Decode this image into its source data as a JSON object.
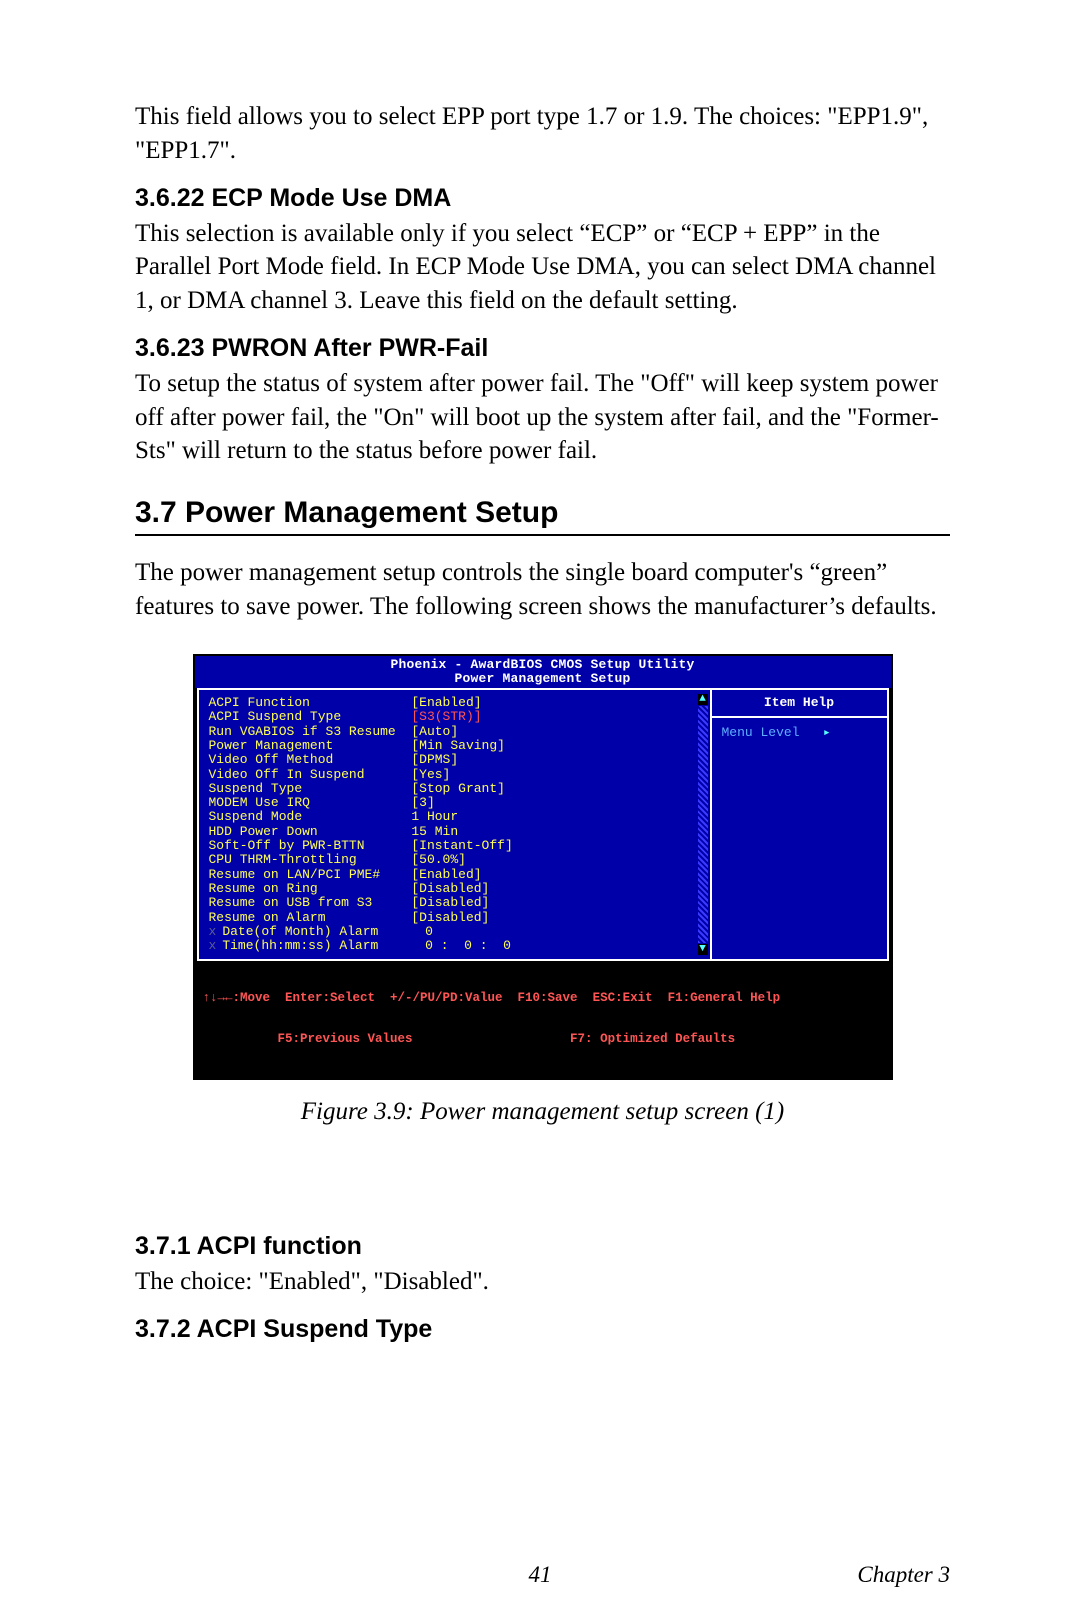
{
  "intro_para": "This field allows you to select EPP port type 1.7 or 1.9. The choices: \"EPP1.9\", \"EPP1.7\".",
  "h_ecp": "3.6.22 ECP Mode Use DMA",
  "p_ecp": "This selection is available only if you select “ECP” or “ECP + EPP” in the Parallel Port Mode field. In ECP Mode Use DMA, you can select DMA channel 1, or DMA channel 3. Leave this field on the default setting.",
  "h_pwron": "3.6.23 PWRON After PWR-Fail",
  "p_pwron": "To setup the status of system after power fail. The \"Off\" will keep system power off after power fail, the \"On\" will boot up the system after fail, and the \"Former-Sts\" will return to the status before power fail.",
  "h_pm": "3.7  Power Management Setup",
  "p_pm": "The power management setup controls the single board computer's “green” features to save power. The following screen shows the manufacturer’s defaults.",
  "bios": {
    "title1": "Phoenix - AwardBIOS CMOS Setup Utility",
    "title2": "Power Management Setup",
    "help_header": "Item Help",
    "help_body": "Menu Level",
    "rows": [
      {
        "label": "ACPI Function",
        "value": "[Enabled]",
        "dim": false,
        "hl": false
      },
      {
        "label": "ACPI Suspend Type",
        "value": "[S3(STR)]",
        "dim": false,
        "hl": true
      },
      {
        "label": "Run VGABIOS if S3 Resume",
        "value": "[Auto]",
        "dim": false,
        "hl": false
      },
      {
        "label": "Power Management",
        "value": "[Min Saving]",
        "dim": false,
        "hl": false
      },
      {
        "label": "Video Off Method",
        "value": "[DPMS]",
        "dim": false,
        "hl": false
      },
      {
        "label": "Video Off In Suspend",
        "value": "[Yes]",
        "dim": false,
        "hl": false
      },
      {
        "label": "Suspend Type",
        "value": "[Stop Grant]",
        "dim": false,
        "hl": false
      },
      {
        "label": "MODEM Use IRQ",
        "value": "[3]",
        "dim": false,
        "hl": false
      },
      {
        "label": "Suspend Mode",
        "value": "1 Hour",
        "dim": true,
        "hl": false
      },
      {
        "label": "HDD Power Down",
        "value": "15 Min",
        "dim": true,
        "hl": false
      },
      {
        "label": "Soft-Off by PWR-BTTN",
        "value": "[Instant-Off]",
        "dim": false,
        "hl": false
      },
      {
        "label": "CPU THRM-Throttling",
        "value": "[50.0%]",
        "dim": false,
        "hl": false
      },
      {
        "label": "Resume on LAN/PCI PME#",
        "value": "[Enabled]",
        "dim": false,
        "hl": false
      },
      {
        "label": "Resume on Ring",
        "value": "[Disabled]",
        "dim": false,
        "hl": false
      },
      {
        "label": "Resume on USB from S3",
        "value": "[Disabled]",
        "dim": false,
        "hl": false
      },
      {
        "label": "Resume on Alarm",
        "value": "[Disabled]",
        "dim": false,
        "hl": false
      },
      {
        "label": "Date(of Month) Alarm",
        "value": "0",
        "dim": true,
        "hl": false,
        "x": true
      },
      {
        "label": "Time(hh:mm:ss) Alarm",
        "value": "0 :  0 :  0",
        "dim": true,
        "hl": false,
        "x": true
      }
    ],
    "footer1": "↑↓→←:Move  Enter:Select  +/-/PU/PD:Value  F10:Save  ESC:Exit  F1:General Help",
    "footer2": "          F5:Previous Values                     F7: Optimized Defaults"
  },
  "fig_caption": "Figure 3.9: Power management setup screen (1)",
  "h_acpi_fn": "3.7.1 ACPI function",
  "p_acpi_fn": "The choice: \"Enabled\", \"Disabled\".",
  "h_acpi_susp": "3.7.2 ACPI Suspend Type",
  "page_num": "41",
  "chapter": "Chapter 3"
}
